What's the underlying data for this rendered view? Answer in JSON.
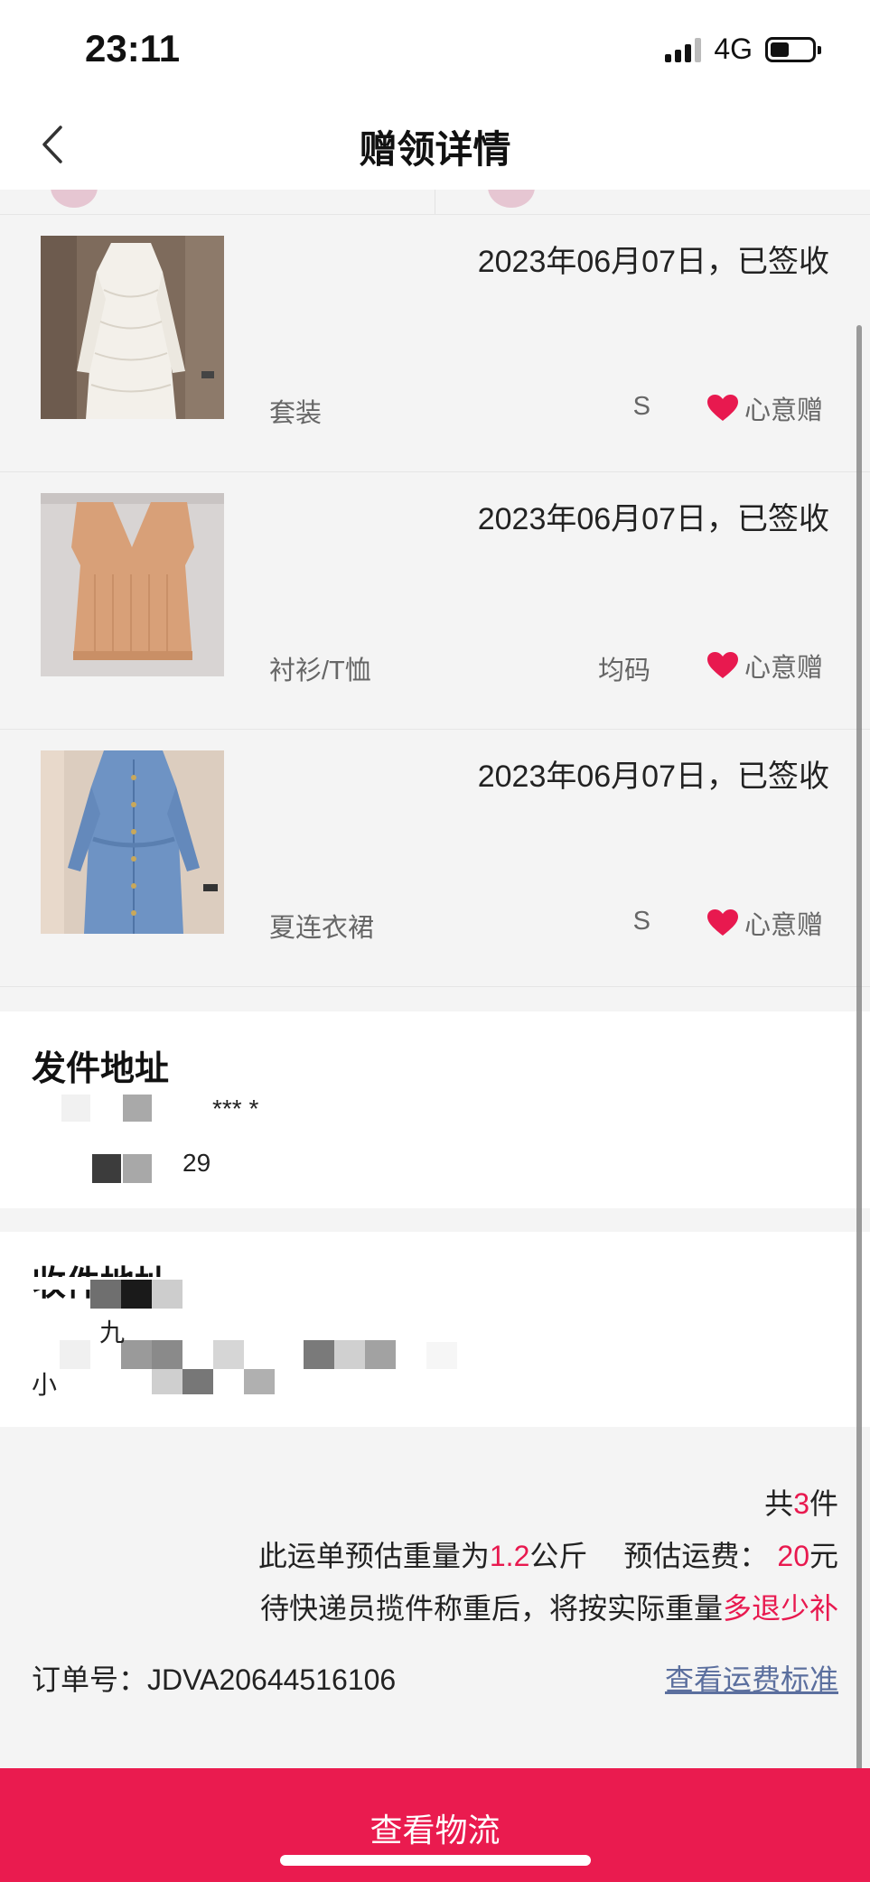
{
  "status_bar": {
    "time": "23:11",
    "network": "4G",
    "battery_level": 0.45
  },
  "nav": {
    "title": "赠领详情",
    "back_icon": "chevron-left-icon"
  },
  "items": [
    {
      "date": "2023年06月07日，已签收",
      "category": "套装",
      "size": "S",
      "tag": "心意赠",
      "thumb": "white-lace-dress"
    },
    {
      "date": "2023年06月07日，已签收",
      "category": "衬衫/T恤",
      "size": "均码",
      "tag": "心意赠",
      "thumb": "tan-knit-vest"
    },
    {
      "date": "2023年06月07日，已签收",
      "category": "夏连衣裙",
      "size": "S",
      "tag": "心意赠",
      "thumb": "denim-dress"
    }
  ],
  "sender": {
    "title": "发件地址",
    "line1": "***  *",
    "line2": "29"
  },
  "receiver": {
    "title": "收件地址",
    "line1": "九",
    "line2": "小"
  },
  "summary": {
    "count_prefix": "共",
    "count": "3",
    "count_suffix": "件",
    "weight_prefix": "此运单预估重量为",
    "weight": "1.2",
    "weight_unit": "公斤",
    "fee_label": "预估运费：",
    "fee": "20",
    "fee_unit": "元",
    "note_prefix": "待快递员揽件称重后，将按实际重量",
    "note_highlight": "多退少补",
    "order_label": "订单号：",
    "order_number": "JDVA20644516106",
    "fee_link": "查看运费标准"
  },
  "bottom_button": {
    "label": "查看物流"
  },
  "colors": {
    "accent": "#e8194f",
    "link": "#5b6f9e",
    "heart": "#e8194f"
  }
}
